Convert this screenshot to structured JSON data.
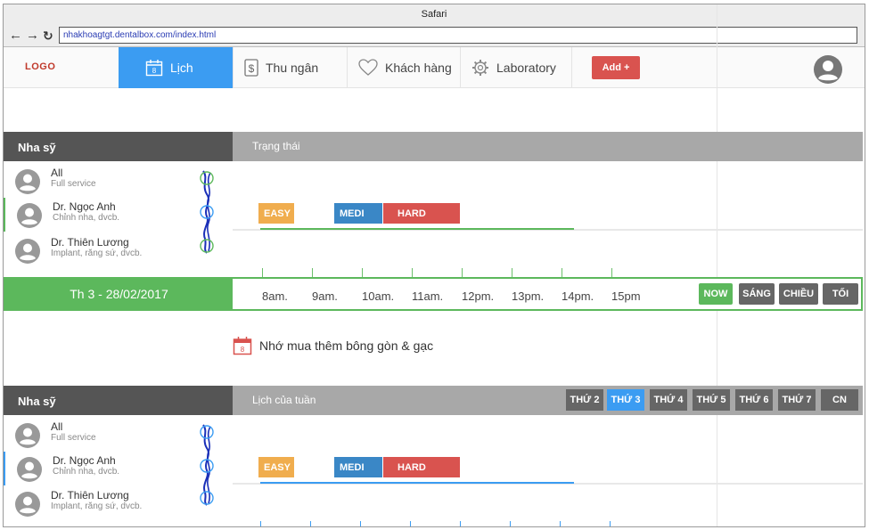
{
  "browser": {
    "title": "Safari",
    "url": "nhakhoagtgt.dentalbox.com/index.html"
  },
  "nav": {
    "logo": "LOGO",
    "tabs": [
      {
        "label": "Lịch",
        "icon": "calendar-icon",
        "active": true
      },
      {
        "label": "Thu ngân",
        "icon": "dollar-icon",
        "active": false
      },
      {
        "label": "Khách hàng",
        "icon": "heart-icon",
        "active": false
      },
      {
        "label": "Laboratory",
        "icon": "gear-icon",
        "active": false
      }
    ],
    "add_label": "Add +",
    "calendar_day": "8"
  },
  "section1": {
    "left_header": "Nha sỹ",
    "right_header": "Trạng thái",
    "dentists": [
      {
        "name": "All",
        "spec": "Full service"
      },
      {
        "name": "Dr. Ngọc Anh",
        "spec": "Chỉnh nha, dvcb."
      },
      {
        "name": "Dr. Thiên Lương",
        "spec": "Implant,  răng sứ, dvcb."
      }
    ],
    "tags": {
      "easy": "EASY",
      "medi": "MEDI",
      "hard": "HARD"
    }
  },
  "timebar": {
    "date": "Th 3 - 28/02/2017",
    "hours": [
      "8am.",
      "9am.",
      "10am.",
      "11am.",
      "12pm.",
      "13pm.",
      "14pm.",
      "15pm"
    ],
    "buttons": [
      "NOW",
      "SÁNG",
      "CHIỀU",
      "TỐI"
    ]
  },
  "note": {
    "text": "Nhớ mua thêm bông gòn & gạc",
    "calendar_day": "8"
  },
  "section2": {
    "left_header": "Nha sỹ",
    "right_header": "Lịch của tuần",
    "days": [
      {
        "label": "THỨ 2",
        "active": false
      },
      {
        "label": "THỨ 3",
        "active": true
      },
      {
        "label": "THỨ 4",
        "active": false
      },
      {
        "label": "THỨ 5",
        "active": false
      },
      {
        "label": "THỨ 6",
        "active": false
      },
      {
        "label": "THỨ 7",
        "active": false
      },
      {
        "label": "CN",
        "active": false
      }
    ],
    "dentists": [
      {
        "name": "All",
        "spec": "Full service"
      },
      {
        "name": "Dr. Ngọc Anh",
        "spec": "Chỉnh nha, dvcb."
      },
      {
        "name": "Dr. Thiên Lương",
        "spec": "Implant,  răng sứ, dvcb."
      }
    ],
    "tags": {
      "easy": "EASY",
      "medi": "MEDI",
      "hard": "HARD"
    }
  },
  "colors": {
    "primary": "#3b9cf2",
    "success": "#5cb85c",
    "danger": "#d9534f",
    "warning": "#f0ad4e",
    "info": "#3a87c6",
    "dark": "#555555",
    "muted": "#a8a8a8"
  }
}
